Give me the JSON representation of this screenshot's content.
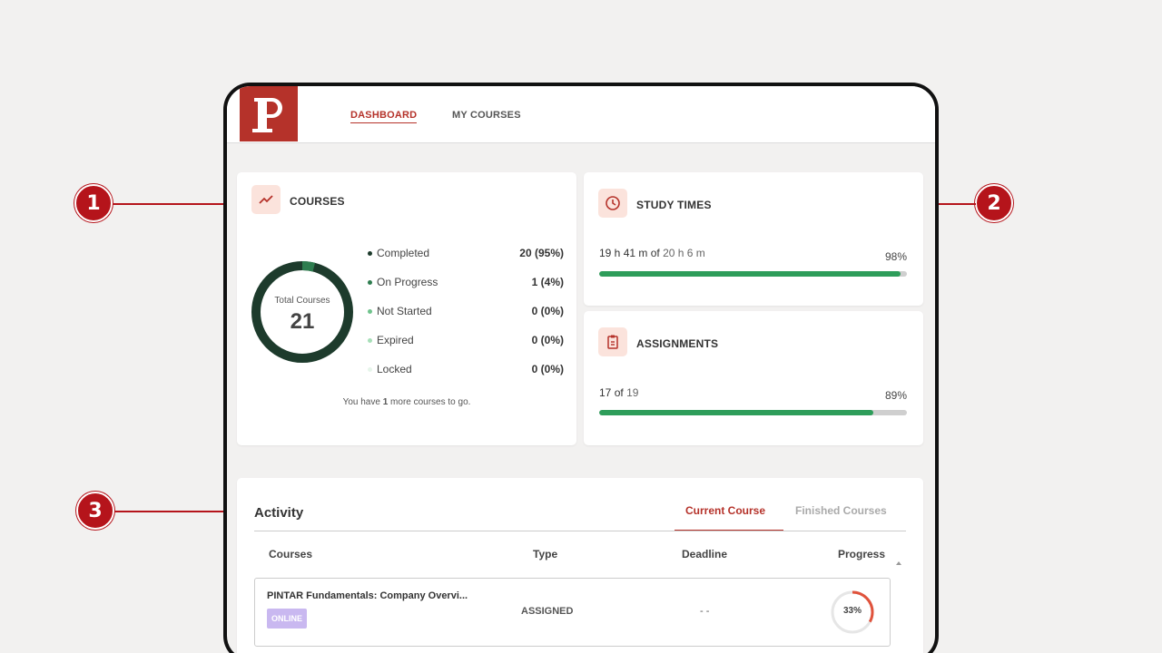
{
  "nav": {
    "dashboard": "DASHBOARD",
    "my_courses": "MY COURSES"
  },
  "courses": {
    "title": "COURSES",
    "total_label": "Total Courses",
    "total_value": "21",
    "legend": [
      {
        "label": "Completed",
        "value": "20 (95%)",
        "color": "#1d3b2c"
      },
      {
        "label": "On Progress",
        "value": "1 (4%)",
        "color": "#2e7d4f"
      },
      {
        "label": "Not Started",
        "value": "0 (0%)",
        "color": "#6fc38c"
      },
      {
        "label": "Expired",
        "value": "0 (0%)",
        "color": "#a7dfb8"
      },
      {
        "label": "Locked",
        "value": "0 (0%)",
        "color": "#e6f5ea"
      }
    ],
    "footer_prefix": "You have",
    "footer_count": "1",
    "footer_suffix": "more courses to go."
  },
  "study_times": {
    "title": "STUDY TIMES",
    "done": "19 h 41 m",
    "of": "of",
    "total": "20 h 6 m",
    "percent": "98%",
    "progress": 0.98
  },
  "assignments": {
    "title": "ASSIGNMENTS",
    "done": "17",
    "of": "of",
    "total": "19",
    "percent": "89%",
    "progress": 0.89
  },
  "activity": {
    "title": "Activity",
    "tabs": {
      "current": "Current Course",
      "finished": "Finished Courses"
    },
    "columns": {
      "courses": "Courses",
      "type": "Type",
      "deadline": "Deadline",
      "progress": "Progress"
    },
    "rows": [
      {
        "name": "PINTAR Fundamentals: Company Overvi...",
        "badge": "ONLINE",
        "type": "ASSIGNED",
        "deadline": "- -",
        "progress": "33%",
        "progress_value": 0.33
      }
    ]
  },
  "callouts": {
    "one": "1",
    "two": "2",
    "three": "3"
  },
  "colors": {
    "brand": "#b5322a",
    "accent_green": "#2e9d5a",
    "badge_purple": "#c9b8f0",
    "ring_red": "#e0533c"
  }
}
